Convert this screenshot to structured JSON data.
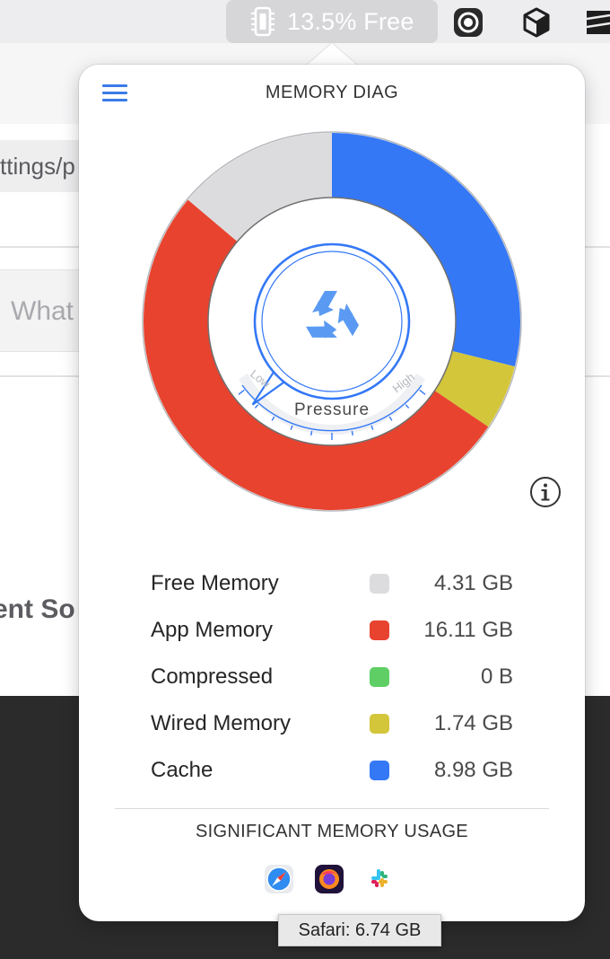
{
  "menubar": {
    "status_text": "13.5% Free",
    "icons": [
      "memory-chip-icon",
      "record-icon",
      "cube-icon",
      "stripes-icon"
    ]
  },
  "background": {
    "url_fragment": "ttings/p",
    "search_placeholder": "What",
    "heading_fragment": "ent So"
  },
  "popover": {
    "title": "MEMORY DIAG",
    "gauge": {
      "center_icon": "recycle-icon",
      "low_label": "Low",
      "high_label": "High",
      "pressure_label": "Pressure",
      "pressure_level": 0.08
    },
    "legend": [
      {
        "label": "Free Memory",
        "value": "4.31 GB",
        "color": "#dcdcdf"
      },
      {
        "label": "App Memory",
        "value": "16.11 GB",
        "color": "#e8432f"
      },
      {
        "label": "Compressed",
        "value": "0 B",
        "color": "#5fcf65"
      },
      {
        "label": "Wired Memory",
        "value": "1.74 GB",
        "color": "#d3c63a"
      },
      {
        "label": "Cache",
        "value": "8.98 GB",
        "color": "#3478f6"
      }
    ],
    "donut_segments_gb": [
      {
        "name": "Cache",
        "value": 8.98,
        "color": "#3478f6"
      },
      {
        "name": "Wired Memory",
        "value": 1.74,
        "color": "#d3c63a"
      },
      {
        "name": "Compressed",
        "value": 0,
        "color": "#5fcf65"
      },
      {
        "name": "App Memory",
        "value": 16.11,
        "color": "#e8432f"
      },
      {
        "name": "Free Memory",
        "value": 4.31,
        "color": "#dcdcdf"
      }
    ],
    "significant_title": "SIGNIFICANT MEMORY USAGE",
    "apps": [
      "safari-icon",
      "firefox-icon",
      "slack-icon"
    ],
    "tooltip": "Safari: 6.74 GB"
  }
}
